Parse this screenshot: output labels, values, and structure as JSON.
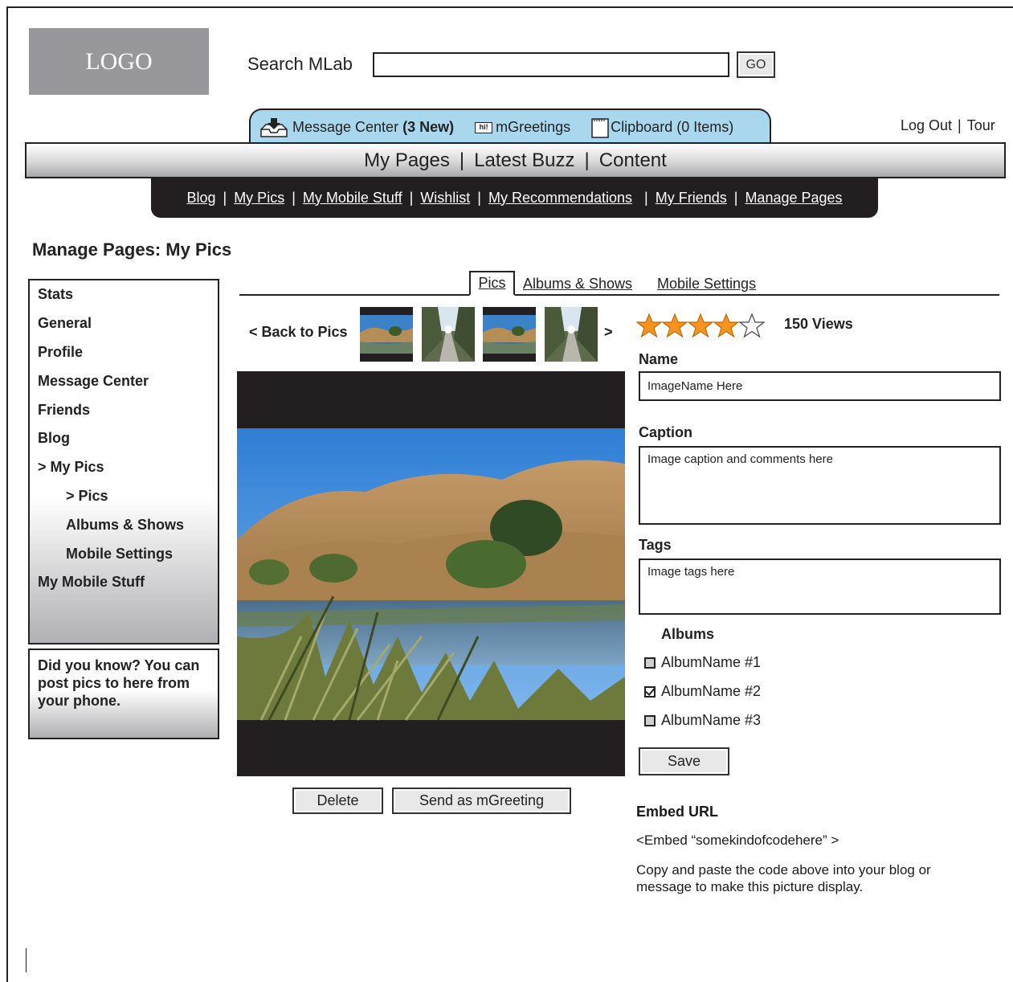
{
  "logo": "LOGO",
  "search": {
    "label": "Search MLab",
    "value": "",
    "button": "GO"
  },
  "message_bar": {
    "message_center": "Message Center",
    "message_count": "(3 New)",
    "mgreetings": "mGreetings",
    "hi_icon_text": "hi!",
    "clipboard": "Clipboard (0 Items)"
  },
  "auth": {
    "logout": "Log Out",
    "sep": "|",
    "tour": "Tour"
  },
  "main_nav": {
    "items": [
      "My Pages",
      "Latest Buzz",
      "Content"
    ],
    "sep": "|"
  },
  "sub_nav": {
    "sep": "|",
    "items": [
      "Blog",
      "My Pics",
      "My Mobile Stuff",
      "Wishlist",
      "My Recommendations",
      "My Friends",
      "Manage Pages"
    ]
  },
  "page_title": "Manage Pages: My Pics",
  "sidebar": {
    "items": [
      "Stats",
      "General",
      "Profile",
      "Message Center",
      "Friends",
      "Blog",
      "> My Pics",
      "> Pics",
      "Albums & Shows",
      "Mobile Settings",
      "My Mobile Stuff"
    ],
    "tip": "Did you know? You can post pics to here from your phone."
  },
  "tabs": {
    "active": "Pics",
    "albums": "Albums & Shows",
    "mobile": "Mobile Settings"
  },
  "nav": {
    "back": "< Back to Pics",
    "next": ">"
  },
  "rating": {
    "stars": 4,
    "max": 5,
    "views": "150 Views"
  },
  "form": {
    "name_label": "Name",
    "name_value": "ImageName Here",
    "caption_label": "Caption",
    "caption_value": "Image caption and comments here",
    "tags_label": "Tags",
    "tags_value": "Image tags here",
    "albums_label": "Albums",
    "albums": [
      "AlbumName #1",
      "AlbumName #2",
      "AlbumName #3"
    ],
    "save": "Save"
  },
  "actions": {
    "delete": "Delete",
    "send": "Send as mGreeting"
  },
  "embed": {
    "title": "Embed URL",
    "code": "<Embed “somekindofcodehere” >",
    "note": "Copy and paste the code above into your blog or message to make this picture display."
  },
  "colors": {
    "message_bar": "#a9d8ee",
    "subnav_bg": "#231f20",
    "star": "#f7941d",
    "logo_bg": "#98989c"
  }
}
